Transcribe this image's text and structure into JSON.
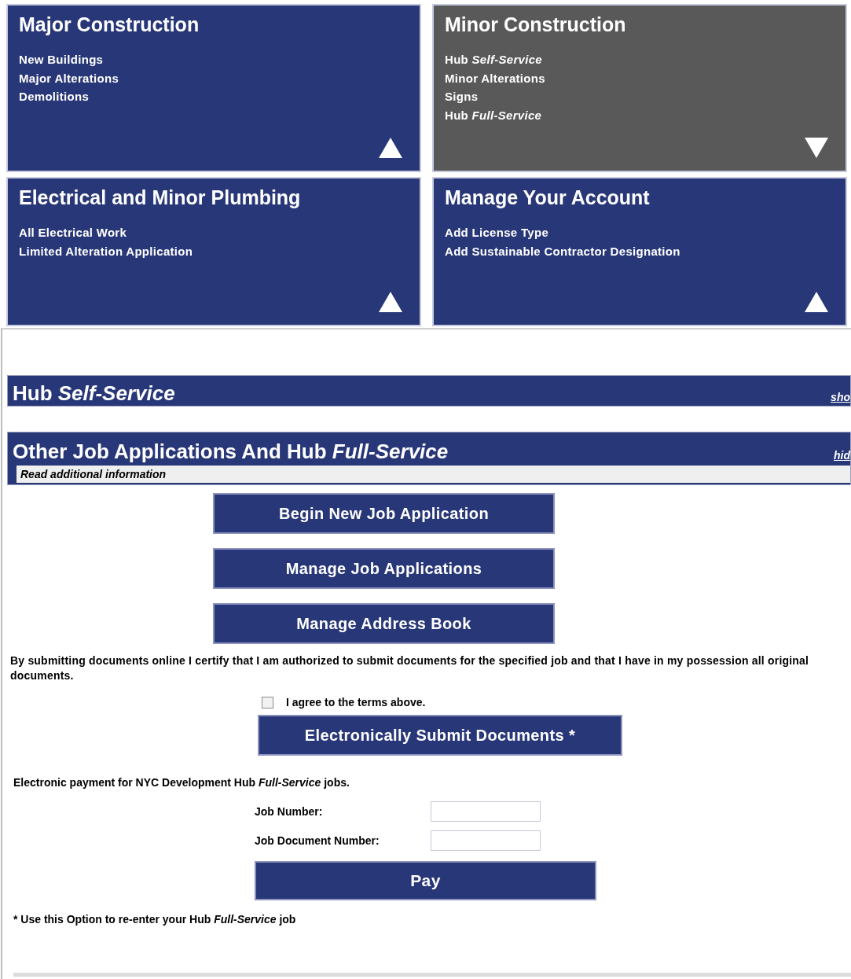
{
  "tiles": [
    {
      "title": "Major Construction",
      "selected": false,
      "items": [
        "New Buildings",
        "Major Alterations",
        "Demolitions"
      ]
    },
    {
      "title": "Minor Construction",
      "selected": true,
      "items": [
        "Hub *Self-Service*",
        "Minor Alterations",
        "Signs",
        "Hub *Full-Service*"
      ]
    },
    {
      "title": "Electrical and Minor Plumbing",
      "selected": false,
      "items": [
        "All Electrical Work",
        "Limited Alteration Application"
      ]
    },
    {
      "title": "Manage Your Account",
      "selected": false,
      "items": [
        "Add License Type",
        "Add Sustainable Contractor Designation"
      ]
    }
  ],
  "sections": [
    {
      "title": "Hub *Self-Service*",
      "toggle": "sho",
      "expanded": false
    },
    {
      "title": "Other Job Applications And Hub *Full-Service*",
      "toggle": "hid",
      "expanded": true,
      "info": "Read additional information"
    }
  ],
  "buttons": [
    "Begin New Job Application",
    "Manage Job Applications",
    "Manage Address Book"
  ],
  "certification": "By submitting documents online I certify that I am authorized to submit documents for the specified job and that I have in my possession all original documents.",
  "agree": {
    "label": "I agree to the terms above.",
    "checked": false
  },
  "submit_button": "Electronically Submit Documents *",
  "payment": {
    "intro": "Electronic payment for NYC Development Hub *Full-Service* jobs.",
    "fields": [
      {
        "label": "Job Number:"
      },
      {
        "label": "Job Document Number:"
      }
    ],
    "button": "Pay"
  },
  "footnote": "* Use this Option to re-enter your Hub *Full-Service* job"
}
